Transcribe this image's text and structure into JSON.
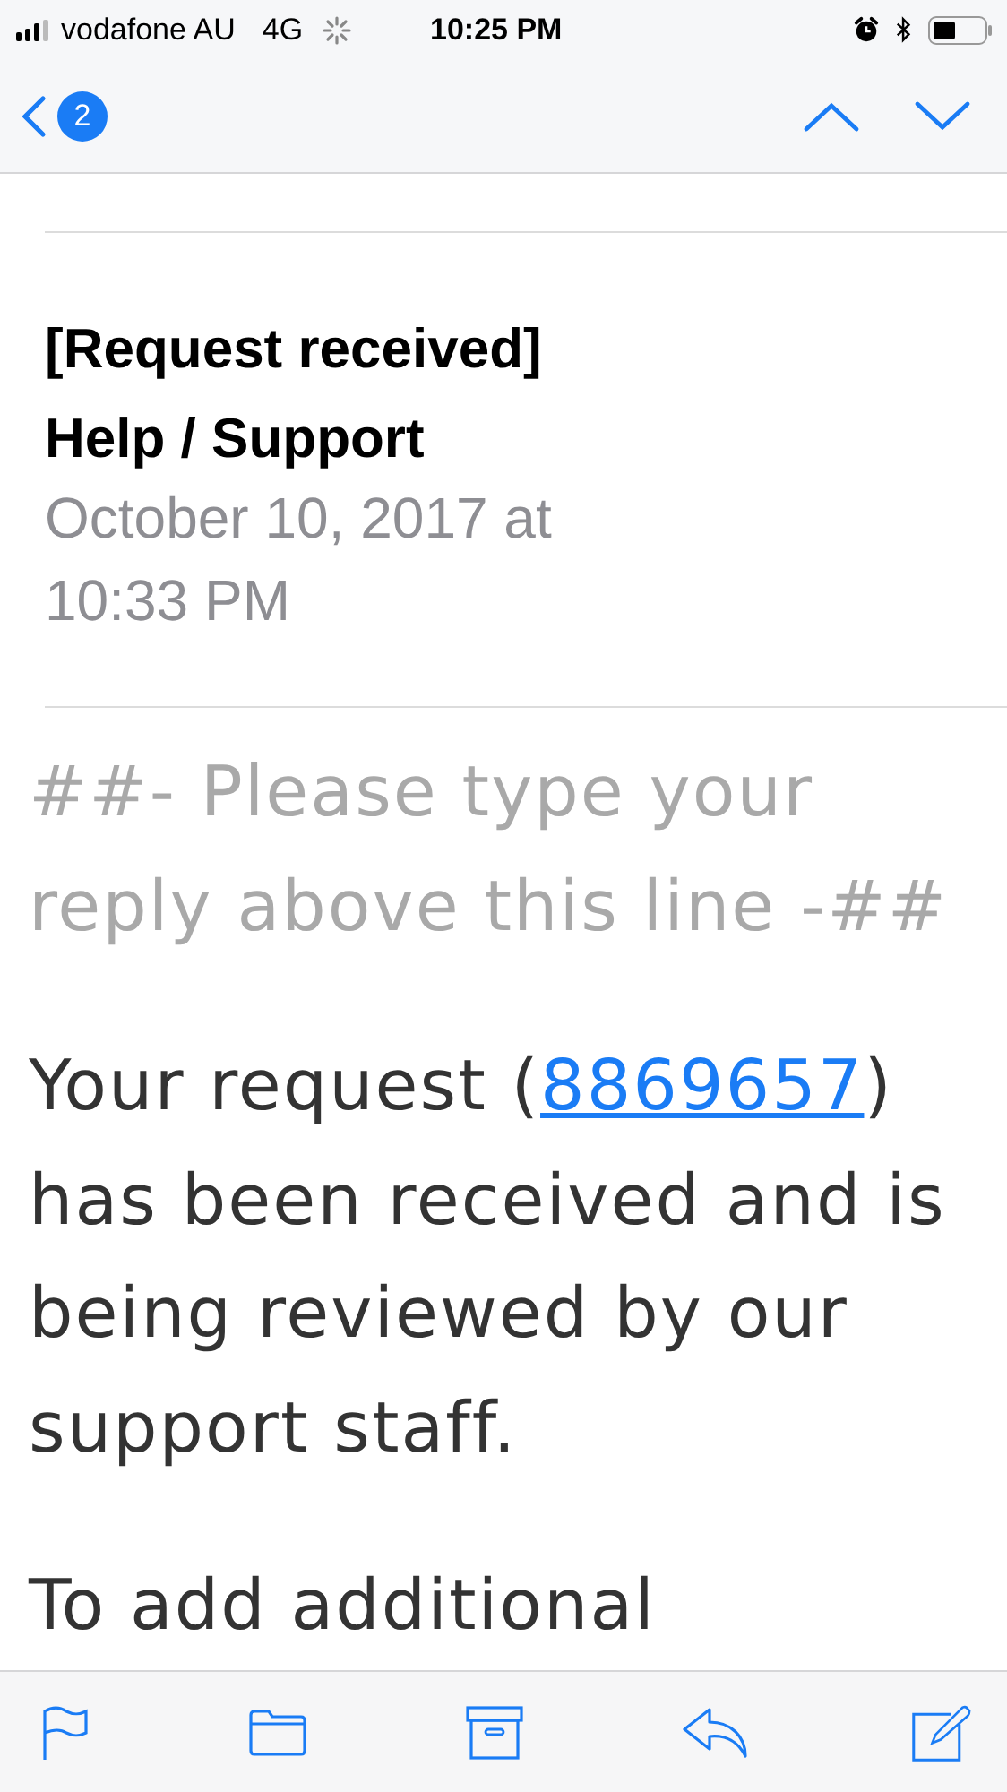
{
  "status_bar": {
    "carrier": "vodafone AU",
    "network": "4G",
    "time": "10:25 PM"
  },
  "nav": {
    "back_badge": "2"
  },
  "email": {
    "subject": "[Request received] Help / Support",
    "date": "October 10, 2017 at 10:33 PM",
    "quote_line": "##- Please type your reply above this line -##",
    "paragraphs": [
      {
        "before": "Your request (",
        "link": "8869657",
        "after": ") has been received and is being reviewed by our support staff."
      },
      {
        "before": "To add additional"
      }
    ]
  }
}
